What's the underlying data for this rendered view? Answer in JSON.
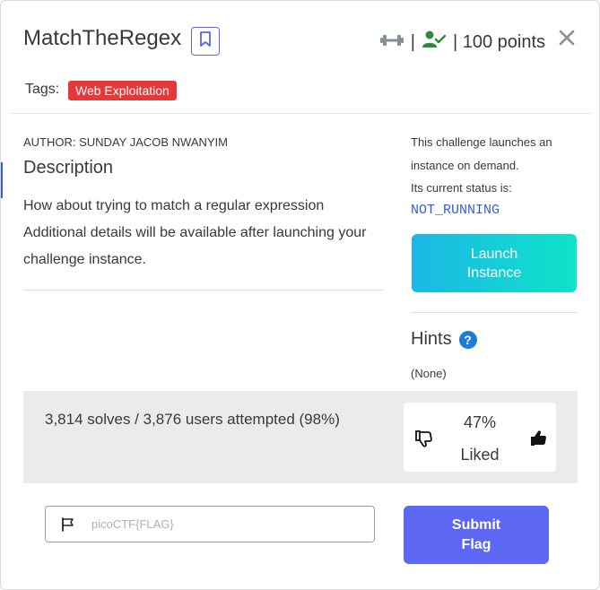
{
  "challenge": {
    "title": "MatchTheRegex",
    "points": "| 100 points",
    "sep": "|",
    "tags_label": "Tags:",
    "tag": "Web Exploitation",
    "author": "AUTHOR: SUNDAY JACOB NWANYIM",
    "description_heading": "Description",
    "description_line1": "How about trying to match a regular expression",
    "description_line2": "Additional details will be available after launching your challenge instance."
  },
  "instance": {
    "info_line1": "This challenge launches an instance on demand.",
    "info_line2": "Its current status is:",
    "status": "NOT_RUNNING",
    "launch_line1": "Launch",
    "launch_line2": "Instance"
  },
  "hints": {
    "heading": "Hints",
    "help_icon_glyph": "?",
    "none_text": "(None)"
  },
  "stats": {
    "solves": "3,814 solves / 3,876 users attempted (98%)",
    "liked_pct": "47%",
    "liked_label": "Liked"
  },
  "flag": {
    "placeholder": "picoCTF{FLAG}",
    "value": "",
    "submit_line1": "Submit",
    "submit_line2": "Flag"
  },
  "icons": {
    "bookmark": "bookmark-icon",
    "difficulty": "dumbbell-icon",
    "solved": "user-check-icon",
    "close": "close-icon",
    "flag": "flag-icon",
    "help": "help-icon",
    "thumbs_down": "thumbs-down-icon",
    "thumbs_up": "thumbs-up-icon"
  },
  "colors": {
    "accent": "#5c67f2",
    "tag_red": "#e5383b",
    "launch_gradient_start": "#1bb7e6",
    "launch_gradient_end": "#0fe3c9",
    "status_blue": "#3b5bdb",
    "solved_green": "#2b8a3e"
  }
}
